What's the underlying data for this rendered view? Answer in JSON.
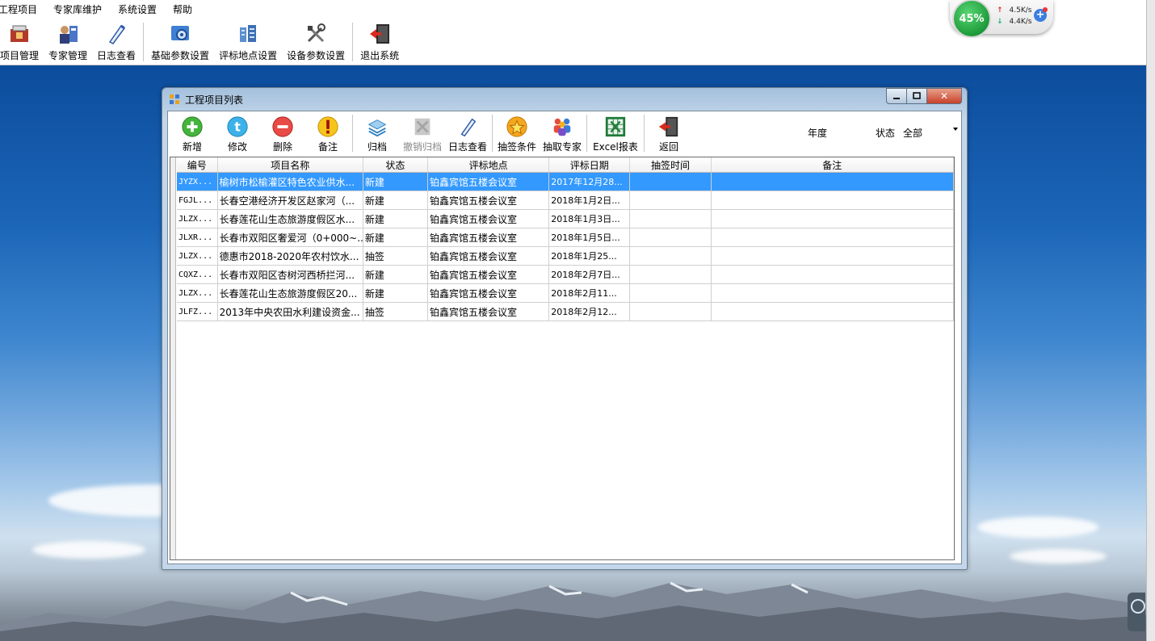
{
  "menubar": {
    "items": [
      "工程项目",
      "专家库维护",
      "系统设置",
      "帮助"
    ]
  },
  "main_toolbar": {
    "buttons": [
      {
        "label": "项目管理",
        "icon": "project-icon"
      },
      {
        "label": "专家管理",
        "icon": "experts-icon"
      },
      {
        "label": "日志查看",
        "icon": "log-icon"
      },
      {
        "label": "基础参数设置",
        "icon": "settings-icon"
      },
      {
        "label": "评标地点设置",
        "icon": "building-icon"
      },
      {
        "label": "设备参数设置",
        "icon": "tools-icon"
      },
      {
        "label": "退出系统",
        "icon": "exit-icon"
      }
    ]
  },
  "speed_widget": {
    "percent": "45%",
    "upload": "4.5K/s",
    "download": "4.4K/s"
  },
  "window": {
    "title": "工程项目列表",
    "toolbar": [
      {
        "label": "新增",
        "icon": "add-icon",
        "enabled": true
      },
      {
        "label": "修改",
        "icon": "edit-icon",
        "enabled": true
      },
      {
        "label": "删除",
        "icon": "delete-icon",
        "enabled": true
      },
      {
        "label": "备注",
        "icon": "note-icon",
        "enabled": true
      },
      {
        "label": "归档",
        "icon": "archive-icon",
        "enabled": true
      },
      {
        "label": "撤销归档",
        "icon": "unarchive-icon",
        "enabled": false
      },
      {
        "label": "日志查看",
        "icon": "log-icon",
        "enabled": true
      },
      {
        "label": "抽签条件",
        "icon": "star-icon",
        "enabled": true
      },
      {
        "label": "抽取专家",
        "icon": "people-icon",
        "enabled": true
      },
      {
        "label": "Excel报表",
        "icon": "excel-icon",
        "enabled": true
      },
      {
        "label": "返回",
        "icon": "back-icon",
        "enabled": true
      }
    ],
    "filter": {
      "year_label": "年度",
      "status_label": "状态",
      "status_value": "全部"
    },
    "grid": {
      "columns": [
        "编号",
        "项目名称",
        "状态",
        "评标地点",
        "评标日期",
        "抽签时间",
        "备注"
      ],
      "rows": [
        [
          "JYZX...",
          "榆树市松榆灌区特色农业供水...",
          "新建",
          "铂鑫宾馆五楼会议室",
          "2017年12月28...",
          "",
          ""
        ],
        [
          "FGJL...",
          "长春空港经济开发区赵家河（...",
          "新建",
          "铂鑫宾馆五楼会议室",
          "2018年1月2日...",
          "",
          ""
        ],
        [
          "JLZX...",
          "长春莲花山生态旅游度假区水...",
          "新建",
          "铂鑫宾馆五楼会议室",
          "2018年1月3日...",
          "",
          ""
        ],
        [
          "JLXR...",
          "长春市双阳区奢爱河（0+000~...",
          "新建",
          "铂鑫宾馆五楼会议室",
          "2018年1月5日...",
          "",
          ""
        ],
        [
          "JLZX...",
          "德惠市2018-2020年农村饮水...",
          "抽签",
          "铂鑫宾馆五楼会议室",
          "2018年1月25...",
          "",
          ""
        ],
        [
          "CQXZ...",
          "长春市双阳区杏树河西桥拦河...",
          "新建",
          "铂鑫宾馆五楼会议室",
          "2018年2月7日...",
          "",
          ""
        ],
        [
          "JLZX...",
          "长春莲花山生态旅游度假区20...",
          "新建",
          "铂鑫宾馆五楼会议室",
          "2018年2月11...",
          "",
          ""
        ],
        [
          "JLFZ...",
          "2013年中央农田水利建设资金...",
          "抽签",
          "铂鑫宾馆五楼会议室",
          "2018年2月12...",
          "",
          ""
        ]
      ],
      "selected_row": 0
    }
  }
}
